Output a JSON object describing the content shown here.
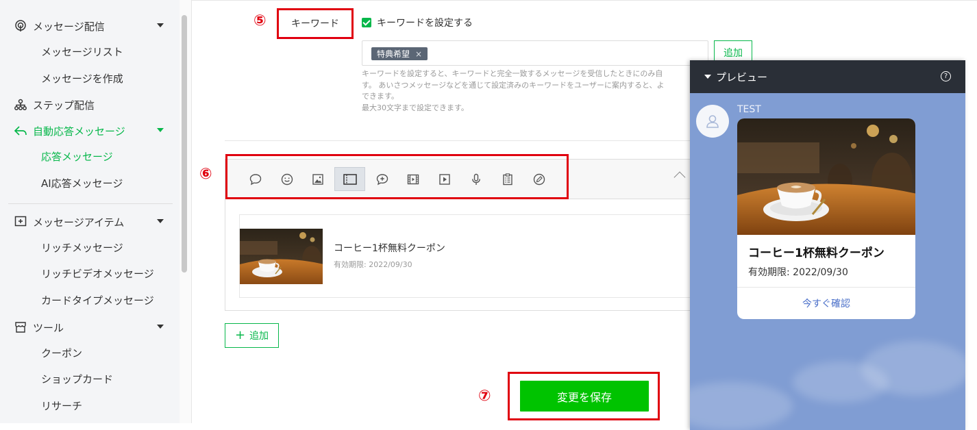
{
  "sidebar": {
    "message_delivery": "メッセージ配信",
    "message_list": "メッセージリスト",
    "create_message": "メッセージを作成",
    "step_delivery": "ステップ配信",
    "auto_response": "自動応答メッセージ",
    "response_message": "応答メッセージ",
    "ai_response": "AI応答メッセージ",
    "message_items": "メッセージアイテム",
    "rich_message": "リッチメッセージ",
    "rich_video_message": "リッチビデオメッセージ",
    "card_type_message": "カードタイプメッセージ",
    "tools": "ツール",
    "coupon": "クーポン",
    "shop_card": "ショップカード",
    "research": "リサーチ"
  },
  "annotations": {
    "five": "⑤",
    "six": "⑥",
    "seven": "⑦"
  },
  "keyword": {
    "label": "キーワード",
    "checkbox_label": "キーワードを設定する",
    "checked": true,
    "tags": [
      "特典希望"
    ],
    "tag_remove": "×",
    "add_label": "追加",
    "help_lines": [
      "キーワードを設定すると、キーワードと完全一致するメッセージを受信したときにのみ自",
      "す。 あいさつメッセージなどを通じて設定済みのキーワードをユーザーに案内すると、よ",
      "できます。",
      "最大30文字まで設定できます。"
    ]
  },
  "toolbar": {
    "icons": [
      "speech-bubble-icon",
      "emoji-icon",
      "image-icon",
      "coupon-icon",
      "add-chat-icon",
      "video-icon",
      "play-icon",
      "microphone-icon",
      "clipboard-icon",
      "pen-icon"
    ],
    "selected_index": 3
  },
  "coupon": {
    "title": "コーヒー1杯無料クーポン",
    "expiry": "有効期限: 2022/09/30"
  },
  "add_button": {
    "plus": "+",
    "label": "追加"
  },
  "save_button": "変更を保存",
  "preview": {
    "title": "プレビュー",
    "help": "?",
    "sender": "TEST",
    "card_title": "コーヒー1杯無料クーポン",
    "card_expiry": "有効期限: 2022/09/30",
    "card_link": "今すぐ確認"
  },
  "colors": {
    "accent": "#06b74a",
    "save": "#00c300",
    "annotation": "#e0000f",
    "preview_bg": "#809dd3",
    "preview_header": "#2a2f37"
  }
}
